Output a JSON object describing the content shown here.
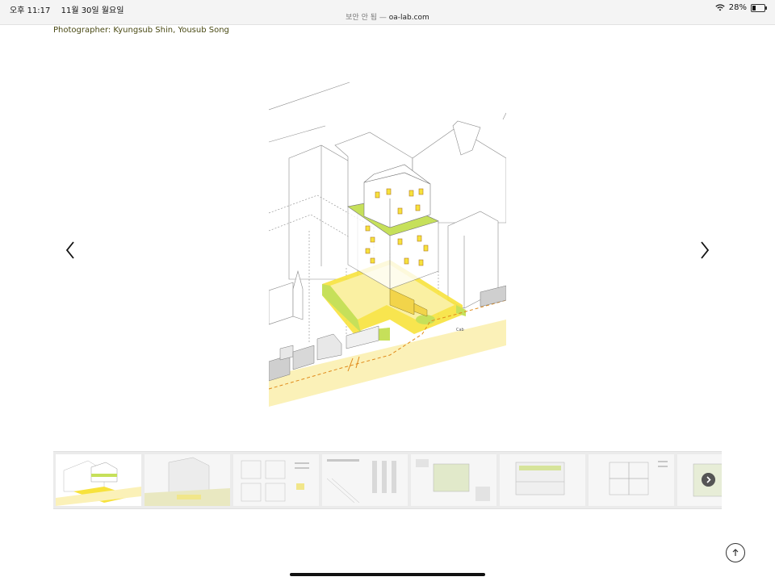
{
  "status_bar": {
    "time": "오후 11:17",
    "date": "11월 30일 월요일",
    "security_label": "보안 안 됨 —",
    "domain": "oa-lab.com",
    "battery_percent": "28%",
    "battery_level": 0.28
  },
  "page": {
    "photographer_credit": "Photographer: Kyungsub Shin, Yousub Song"
  },
  "gallery": {
    "main_image": "axonometric-diagram-of-building-with-highlighted-yellow-ground-floor-and-green-roof",
    "main_image_label": "Cab",
    "thumbnail_count": 8,
    "active_thumbnail": 1
  },
  "icons": {
    "prev": "chevron-left-icon",
    "next": "chevron-right-icon",
    "strip_next": "circle-chevron-right-icon",
    "scroll_top": "arrow-up-icon",
    "wifi": "wifi-icon",
    "battery": "battery-icon"
  },
  "colors": {
    "accent_yellow": "#f7e23c",
    "accent_green": "#c6e05a",
    "credit_text": "#4a4a14"
  }
}
